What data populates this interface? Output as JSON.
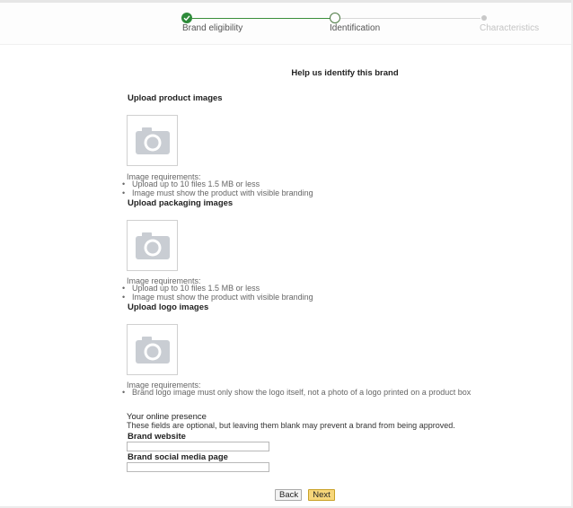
{
  "stepper": {
    "steps": [
      {
        "label": "Brand eligibility",
        "state": "complete"
      },
      {
        "label": "Identification",
        "state": "current"
      },
      {
        "label": "Characteristics",
        "state": "upcoming"
      }
    ],
    "colors": {
      "complete": "#2e8b3a",
      "upcoming": "#c8c8c8"
    }
  },
  "page": {
    "title": "Help us identify this brand"
  },
  "sections": [
    {
      "title": "Upload product images",
      "icon": "camera-icon",
      "requirements_title": "Image requirements:",
      "requirements": [
        "Upload up to 10 files 1.5 MB or less",
        "Image must show the product with visible branding"
      ]
    },
    {
      "title": "Upload packaging images",
      "icon": "camera-icon",
      "requirements_title": "Image requirements:",
      "requirements": [
        "Upload up to 10 files 1.5 MB or less",
        "Image must show the product with visible branding"
      ]
    },
    {
      "title": "Upload logo images",
      "icon": "camera-icon",
      "requirements_title": "Image requirements:",
      "requirements": [
        "Brand logo image must only show the logo itself, not a photo of a logo printed on a product box"
      ]
    }
  ],
  "online_presence": {
    "title": "Your online presence",
    "note": "These fields are optional, but leaving them blank may prevent a brand from being approved.",
    "website_label": "Brand website",
    "website_value": "",
    "social_label": "Brand social media page",
    "social_value": ""
  },
  "buttons": {
    "back": "Back",
    "next": "Next",
    "next_color": "#f7d67a"
  }
}
